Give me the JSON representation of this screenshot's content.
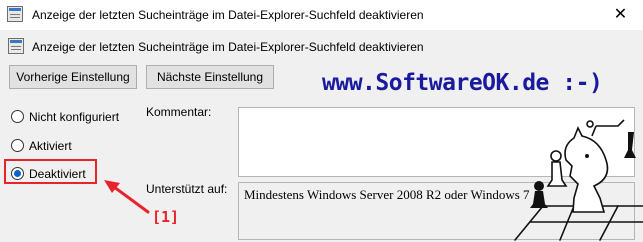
{
  "window": {
    "title": "Anzeige der letzten Sucheinträge im Datei-Explorer-Suchfeld deaktivieren",
    "close_symbol": "✕"
  },
  "header": {
    "title": "Anzeige der letzten Sucheinträge im Datei-Explorer-Suchfeld deaktivieren",
    "icon": "policy-setting-icon"
  },
  "toolbar": {
    "prev_label": "Vorherige Einstellung",
    "next_label": "Nächste Einstellung"
  },
  "watermark": "www.SoftwareOK.de :-)",
  "options": [
    {
      "label": "Nicht konfiguriert",
      "checked": false
    },
    {
      "label": "Aktiviert",
      "checked": false
    },
    {
      "label": "Deaktiviert",
      "checked": true
    }
  ],
  "fields": {
    "comment_label": "Kommentar:",
    "comment_value": "",
    "supported_label": "Unterstützt auf:",
    "supported_value": "Mindestens Windows Server 2008 R2 oder Windows 7"
  },
  "annotation": {
    "label": "[1]",
    "color": "#e8232a"
  },
  "colors": {
    "accent": "#0a63c9",
    "watermark": "#1a1a9e",
    "highlight": "#e8232a"
  }
}
